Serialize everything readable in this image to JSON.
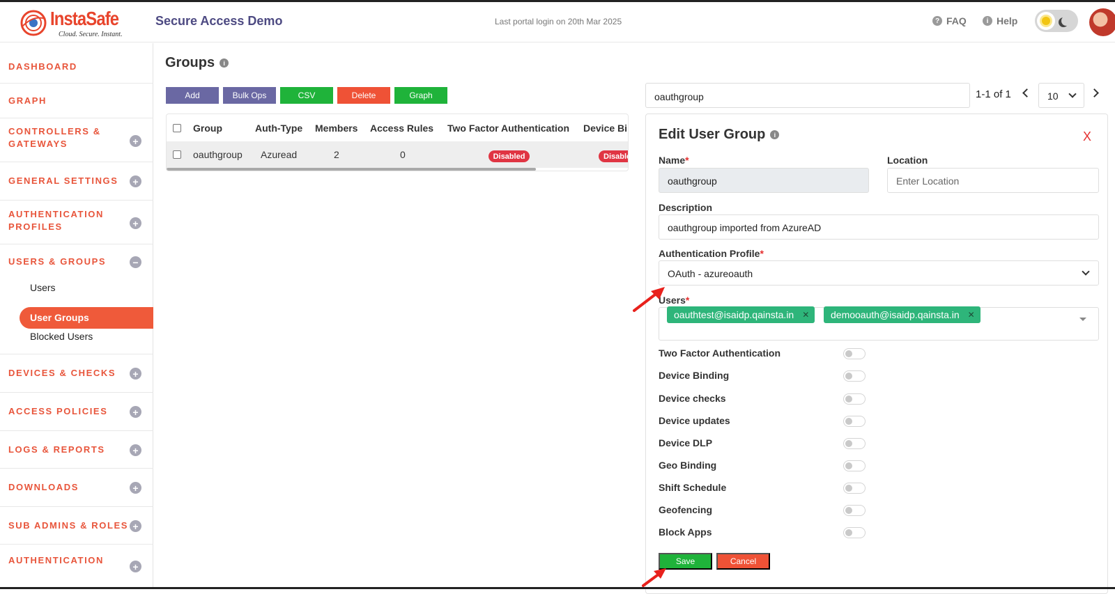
{
  "header": {
    "brand": "InstaSafe",
    "tagline": "Cloud. Secure. Instant.",
    "app_title": "Secure Access Demo",
    "last_login": "Last portal login on 20th Mar 2025",
    "faq_label": "FAQ",
    "help_label": "Help"
  },
  "sidebar": {
    "sections": [
      {
        "label": "DASHBOARD"
      },
      {
        "label": "GRAPH"
      },
      {
        "label": "CONTROLLERS & GATEWAYS"
      },
      {
        "label": "GENERAL SETTINGS"
      },
      {
        "label": "AUTHENTICATION PROFILES"
      },
      {
        "label": "USERS & GROUPS"
      },
      {
        "label": "DEVICES & CHECKS"
      },
      {
        "label": "ACCESS POLICIES"
      },
      {
        "label": "LOGS & REPORTS"
      },
      {
        "label": "DOWNLOADS"
      },
      {
        "label": "SUB ADMINS & ROLES"
      },
      {
        "label": "AUTHENTICATION"
      }
    ],
    "sub_items": [
      "Users",
      "User Groups",
      "Blocked Users"
    ],
    "active_sub_item": "User Groups"
  },
  "groups": {
    "title": "Groups",
    "buttons": {
      "add": "Add",
      "bulk_ops": "Bulk Ops",
      "csv": "CSV",
      "delete": "Delete",
      "graph": "Graph"
    },
    "columns": [
      "Group",
      "Auth-Type",
      "Members",
      "Access Rules",
      "Two Factor Authentication",
      "Device Bi"
    ],
    "rows": [
      {
        "group": "oauthgroup",
        "auth_type": "Azuread",
        "members": "2",
        "access_rules": "0",
        "two_factor": "Disabled",
        "device_binding": "Disable"
      }
    ]
  },
  "search": {
    "value": "oauthgroup"
  },
  "pagination": {
    "range": "1-1 of 1",
    "page_size": "10"
  },
  "edit_panel": {
    "title": "Edit User Group",
    "close_label": "X",
    "name_label": "Name",
    "name_value": "oauthgroup",
    "location_label": "Location",
    "location_placeholder": "Enter Location",
    "description_label": "Description",
    "description_value": "oauthgroup imported from AzureAD",
    "auth_profile_label": "Authentication Profile",
    "auth_profile_value": "OAuth - azureoauth",
    "users_label": "Users",
    "users": [
      "oauthtest@isaidp.qainsta.in",
      "demooauth@isaidp.qainsta.in"
    ],
    "toggles": [
      {
        "label": "Two Factor Authentication",
        "on": false
      },
      {
        "label": "Device Binding",
        "on": false
      },
      {
        "label": "Device checks",
        "on": false
      },
      {
        "label": "Device updates",
        "on": false
      },
      {
        "label": "Device DLP",
        "on": false
      },
      {
        "label": "Geo Binding",
        "on": false
      },
      {
        "label": "Shift Schedule",
        "on": false
      },
      {
        "label": "Geofencing",
        "on": false
      },
      {
        "label": "Block Apps",
        "on": false
      }
    ],
    "save_label": "Save",
    "cancel_label": "Cancel"
  },
  "colors": {
    "accent": "#ef5a3a",
    "purple": "#6a68a3",
    "green": "#1fb33a",
    "red": "#ef5236",
    "tag_green": "#2eb57a"
  }
}
